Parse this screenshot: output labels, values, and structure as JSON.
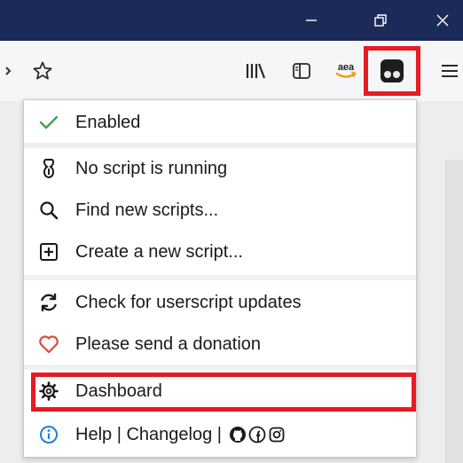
{
  "menu": {
    "enabled": "Enabled",
    "no_script": "No script is running",
    "find_scripts": "Find new scripts...",
    "create_script": "Create a new script...",
    "check_updates": "Check for userscript updates",
    "donation": "Please send a donation",
    "dashboard": "Dashboard",
    "help": "Help",
    "separator": " | ",
    "changelog": "Changelog",
    "separator2": " | "
  },
  "toolbar": {
    "amazon_label": "aea"
  },
  "colors": {
    "check": "#3fa34d",
    "heart": "#e0493b",
    "info": "#1f7fd6",
    "highlight": "#e81a24",
    "titlebar": "#1c2a5a"
  }
}
